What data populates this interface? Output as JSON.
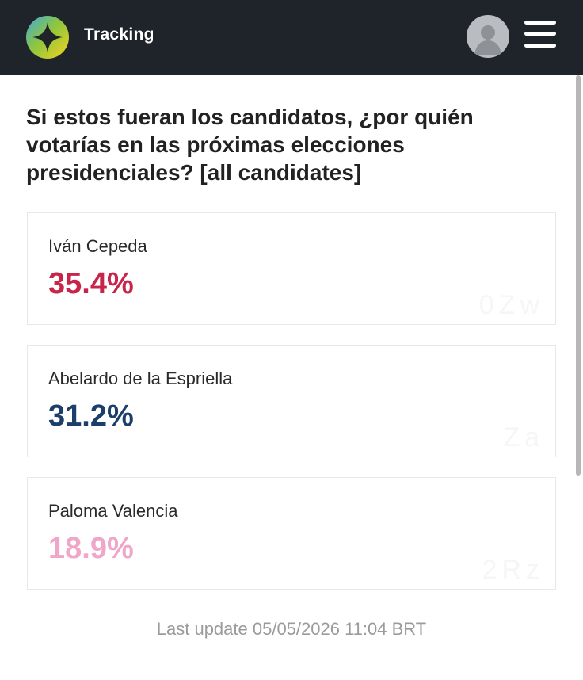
{
  "header": {
    "app_title": "Tracking",
    "logo_icon": "tracking-logo-icon",
    "avatar_icon": "user-avatar-icon",
    "menu_icon": "hamburger-menu-icon",
    "background_color": "#1f242b"
  },
  "main": {
    "question": "Si estos fueran los candidatos, ¿por quién votarías en las próximas elecciones presidenciales? [all candidates]",
    "candidates": [
      {
        "name": "Iván Cepeda",
        "percent": "35.4%",
        "color": "#c8254b"
      },
      {
        "name": "Abelardo de la Espriella",
        "percent": "31.2%",
        "color": "#1b3e6b"
      },
      {
        "name": "Paloma Valencia",
        "percent": "18.9%",
        "color": "#f0a6c8"
      }
    ],
    "last_update": "Last update 05/05/2026 11:04 BRT"
  }
}
